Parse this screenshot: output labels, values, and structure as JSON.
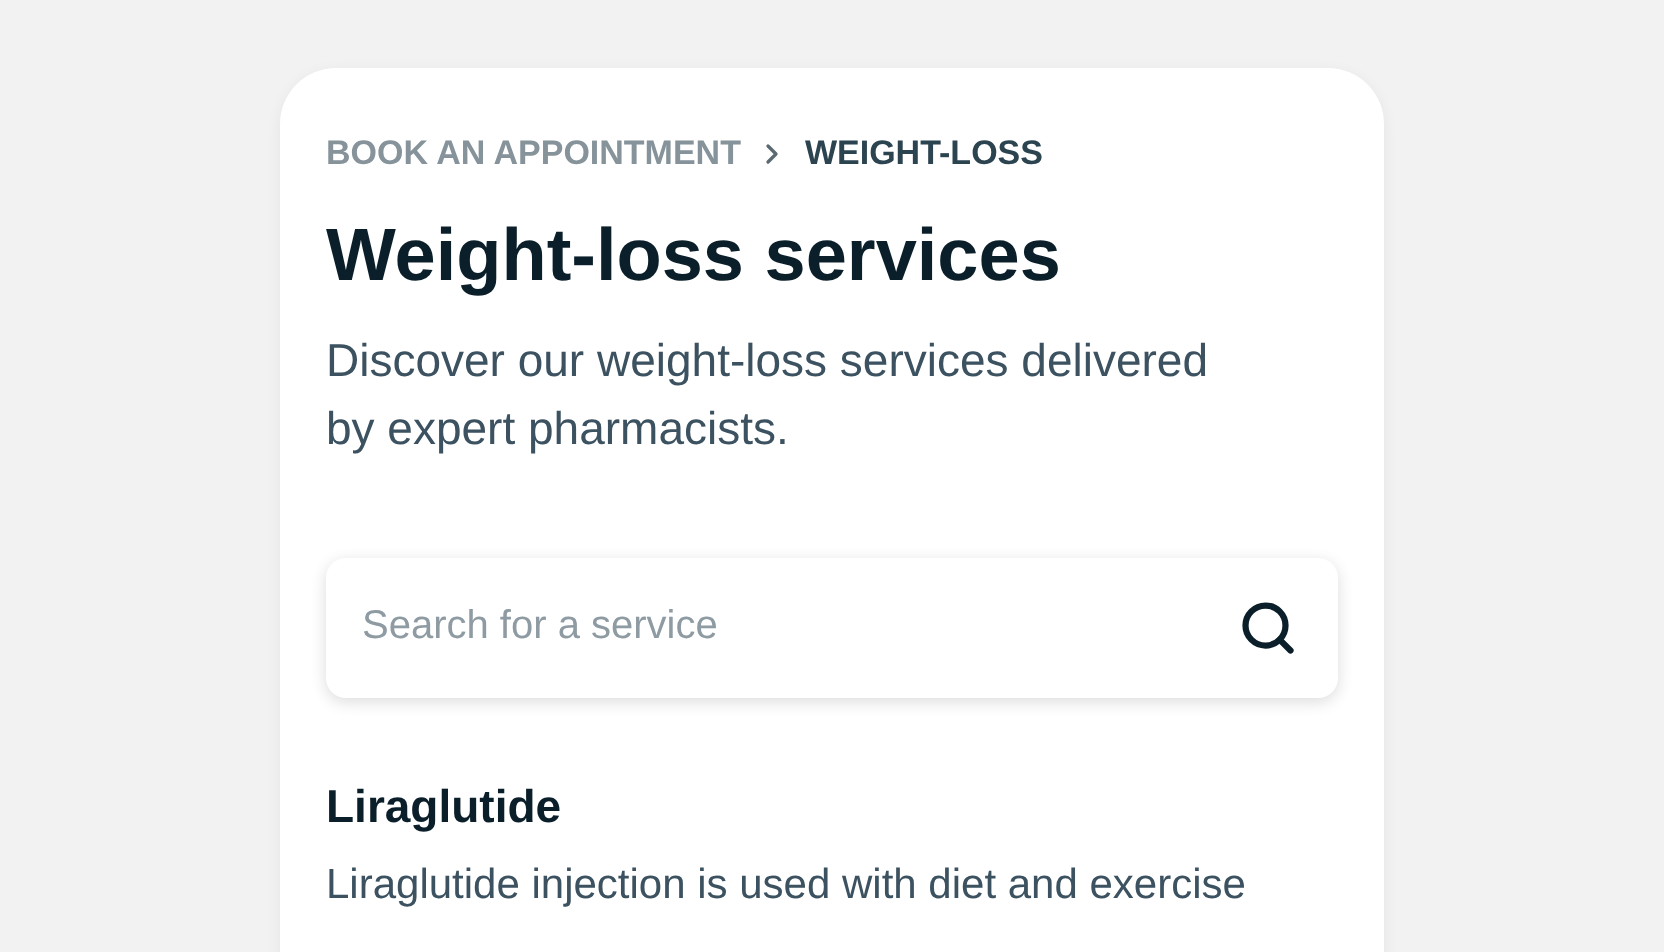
{
  "breadcrumb": [
    {
      "label": "BOOK AN APPOINTMENT",
      "current": false
    },
    {
      "label": "WEIGHT-LOSS",
      "current": true
    }
  ],
  "title": "Weight-loss services",
  "description": "Discover our weight-loss services delivered by expert pharmacists.",
  "search": {
    "placeholder": "Search for a service"
  },
  "services": [
    {
      "name": "Liraglutide",
      "description": "Liraglutide injection is used with diet and exercise"
    }
  ]
}
